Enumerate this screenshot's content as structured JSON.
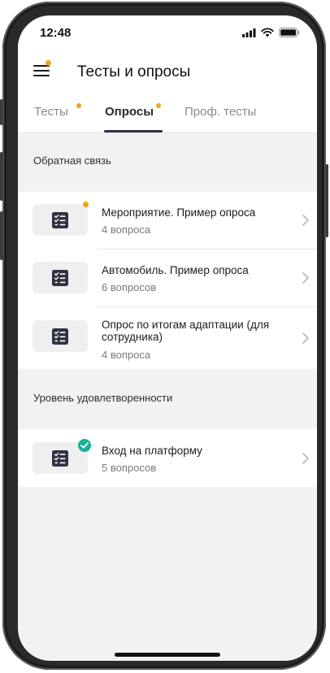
{
  "status": {
    "time": "12:48"
  },
  "header": {
    "title": "Тесты и опросы"
  },
  "tabs": [
    {
      "label": "Тесты",
      "active": false,
      "notification_dot": true
    },
    {
      "label": "Опросы",
      "active": true,
      "notification_dot": true
    },
    {
      "label": "Проф. тесты",
      "active": false,
      "notification_dot": false
    }
  ],
  "sections": [
    {
      "title": "Обратная связь",
      "items": [
        {
          "title": "Мероприятие. Пример опроса",
          "subtitle": "4 вопроса",
          "status": "new"
        },
        {
          "title": "Автомобиль. Пример опроса",
          "subtitle": "6 вопросов",
          "status": "none"
        },
        {
          "title": "Опрос по итогам адаптации (для сотрудника)",
          "subtitle": "4 вопроса",
          "status": "none"
        }
      ]
    },
    {
      "title": "Уровень удовлетворенности",
      "items": [
        {
          "title": "Вход на платформу",
          "subtitle": "5 вопросов",
          "status": "completed"
        }
      ]
    }
  ],
  "icons": {
    "menu": "hamburger-menu-icon",
    "survey": "checklist-icon",
    "chevron": "chevron-right-icon",
    "completed": "checkmark-icon"
  },
  "colors": {
    "accent_dot": "#f2a31c",
    "completed": "#19b394",
    "icon_dark": "#2f3242"
  }
}
